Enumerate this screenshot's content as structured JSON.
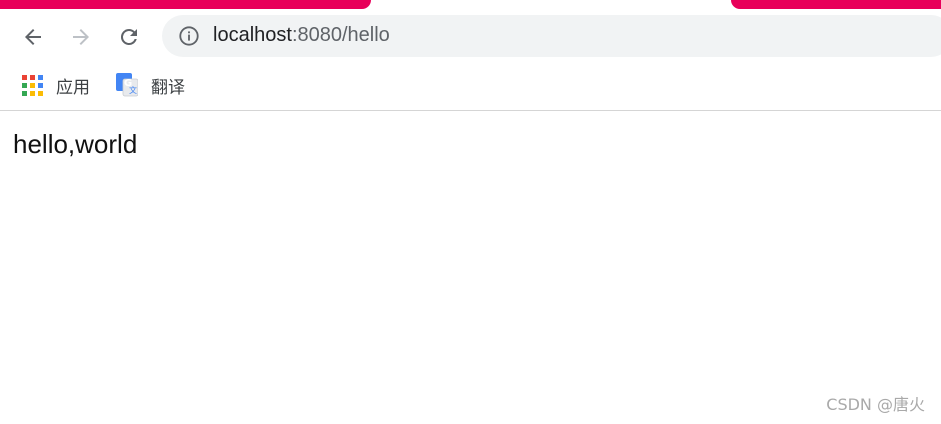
{
  "browser": {
    "accent_color": "#e8005a",
    "nav": {
      "back_icon": "arrow-left-icon",
      "forward_icon": "arrow-right-icon",
      "reload_icon": "reload-icon"
    },
    "omnibox": {
      "icon": "info-icon",
      "url_host": "localhost",
      "url_rest": ":8080/hello"
    },
    "bookmarks": [
      {
        "label": "应用",
        "icon": "apps-grid-icon"
      },
      {
        "label": "翻译",
        "icon": "google-translate-icon"
      }
    ]
  },
  "page": {
    "body_text": "hello,world"
  },
  "watermark": "CSDN @唐火"
}
